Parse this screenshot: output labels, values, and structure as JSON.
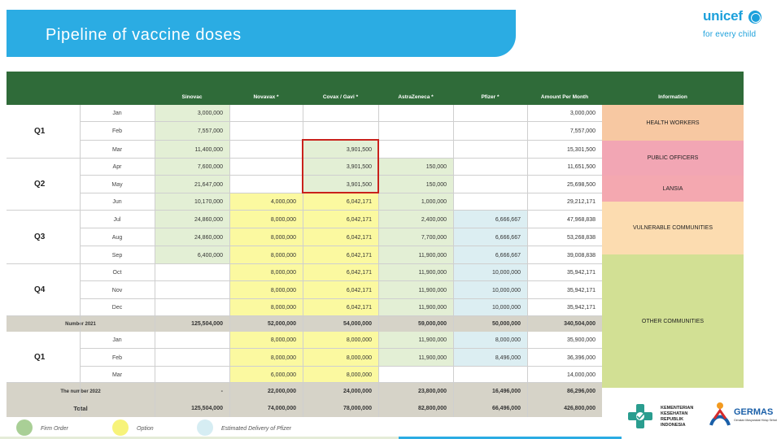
{
  "page": {
    "title": "Pipeline of vaccine doses"
  },
  "unicef": {
    "wordmark": "unicef",
    "tagline": "for every child"
  },
  "table": {
    "headers": [
      "Sinovac",
      "Novavax *",
      "Covax / Gavi *",
      "AstraZeneca *",
      "Pfizer *",
      "Amount Per Month",
      "Information"
    ],
    "quarters": [
      "Q1",
      "Q2",
      "Q3",
      "Q4",
      "Q1"
    ],
    "rows": [
      {
        "month": "Jan",
        "sinovac": "3,000,000",
        "novavax": "",
        "covax": "",
        "astrazeneca": "",
        "pfizer": "",
        "total": "3,000,000"
      },
      {
        "month": "Feb",
        "sinovac": "7,557,000",
        "novavax": "",
        "covax": "",
        "astrazeneca": "",
        "pfizer": "",
        "total": "7,557,000"
      },
      {
        "month": "Mar",
        "sinovac": "11,400,000",
        "novavax": "",
        "covax": "3,901,500",
        "astrazeneca": "",
        "pfizer": "",
        "total": "15,301,500"
      },
      {
        "month": "Apr",
        "sinovac": "7,600,000",
        "novavax": "",
        "covax": "3,901,500",
        "astrazeneca": "150,000",
        "pfizer": "",
        "total": "11,651,500"
      },
      {
        "month": "May",
        "sinovac": "21,647,000",
        "novavax": "",
        "covax": "3,901,500",
        "astrazeneca": "150,000",
        "pfizer": "",
        "total": "25,698,500"
      },
      {
        "month": "Jun",
        "sinovac": "10,170,000",
        "novavax": "4,000,000",
        "covax": "6,042,171",
        "astrazeneca": "1,000,000",
        "pfizer": "",
        "total": "29,212,171"
      },
      {
        "month": "Jul",
        "sinovac": "24,860,000",
        "novavax": "8,000,000",
        "covax": "6,042,171",
        "astrazeneca": "2,400,000",
        "pfizer": "6,666,667",
        "total": "47,968,838"
      },
      {
        "month": "Aug",
        "sinovac": "24,860,000",
        "novavax": "8,000,000",
        "covax": "6,042,171",
        "astrazeneca": "7,700,000",
        "pfizer": "6,666,667",
        "total": "53,268,838"
      },
      {
        "month": "Sep",
        "sinovac": "6,400,000",
        "novavax": "8,000,000",
        "covax": "6,042,171",
        "astrazeneca": "11,900,000",
        "pfizer": "6,666,667",
        "total": "39,008,838"
      },
      {
        "month": "Oct",
        "sinovac": "",
        "novavax": "8,000,000",
        "covax": "6,042,171",
        "astrazeneca": "11,900,000",
        "pfizer": "10,000,000",
        "total": "35,942,171"
      },
      {
        "month": "Nov",
        "sinovac": "",
        "novavax": "8,000,000",
        "covax": "6,042,171",
        "astrazeneca": "11,900,000",
        "pfizer": "10,000,000",
        "total": "35,942,171"
      },
      {
        "month": "Dec",
        "sinovac": "",
        "novavax": "8,000,000",
        "covax": "6,042,171",
        "astrazeneca": "11,900,000",
        "pfizer": "10,000,000",
        "total": "35,942,171"
      }
    ],
    "subtotal_2021": {
      "label": "Number 2021",
      "sinovac": "125,504,000",
      "novavax": "52,000,000",
      "covax": "54,000,000",
      "astrazeneca": "59,000,000",
      "pfizer": "50,000,000",
      "total": "340,504,000"
    },
    "rows_2022": [
      {
        "month": "Jan",
        "sinovac": "",
        "novavax": "8,000,000",
        "covax": "8,000,000",
        "astrazeneca": "11,900,000",
        "pfizer": "8,000,000",
        "total": "35,900,000"
      },
      {
        "month": "Feb",
        "sinovac": "",
        "novavax": "8,000,000",
        "covax": "8,000,000",
        "astrazeneca": "11,900,000",
        "pfizer": "8,496,000",
        "total": "36,396,000"
      },
      {
        "month": "Mar",
        "sinovac": "",
        "novavax": "6,000,000",
        "covax": "8,000,000",
        "astrazeneca": "",
        "pfizer": "",
        "total": "14,000,000"
      }
    ],
    "subtotal_2022": {
      "label": "The number 2022",
      "sinovac": "-",
      "novavax": "22,000,000",
      "covax": "24,000,000",
      "astrazeneca": "23,800,000",
      "pfizer": "16,496,000",
      "total": "86,296,000"
    },
    "grand_total": {
      "label": "Total",
      "sinovac": "125,504,000",
      "novavax": "74,000,000",
      "covax": "78,000,000",
      "astrazeneca": "82,800,000",
      "pfizer": "66,496,000",
      "total": "426,800,000"
    },
    "information_bands": [
      {
        "label": "HEALTH WORKERS",
        "color": "#f7c8a2"
      },
      {
        "label": "PUBLIC OFFICERS",
        "color": "#f2a6b4"
      },
      {
        "label": "LANSIA",
        "color": "#f4a8b0"
      },
      {
        "label": "VULNERABLE COMMUNITIES",
        "color": "#fcdcb0"
      },
      {
        "label": "OTHER COMMUNITIES",
        "color": "#d2e094"
      }
    ]
  },
  "legend": [
    {
      "label": "Firm Order",
      "color": "#a9cf96"
    },
    {
      "label": "Option",
      "color": "#f7f37a"
    },
    {
      "label": "Estimated Delivery of Pfizer",
      "color": "#d6edf3"
    }
  ],
  "partners": {
    "kemkes": "KEMENTERIAN KESEHATAN REPUBLIK INDONESIA",
    "germas": "GERMAS",
    "germas_sub": "Gerakan Masyarakat Hidup Sehat"
  },
  "colors": {
    "banner": "#2bace3",
    "header_bar": "#2f6b39",
    "highlight": "#c9221c"
  }
}
